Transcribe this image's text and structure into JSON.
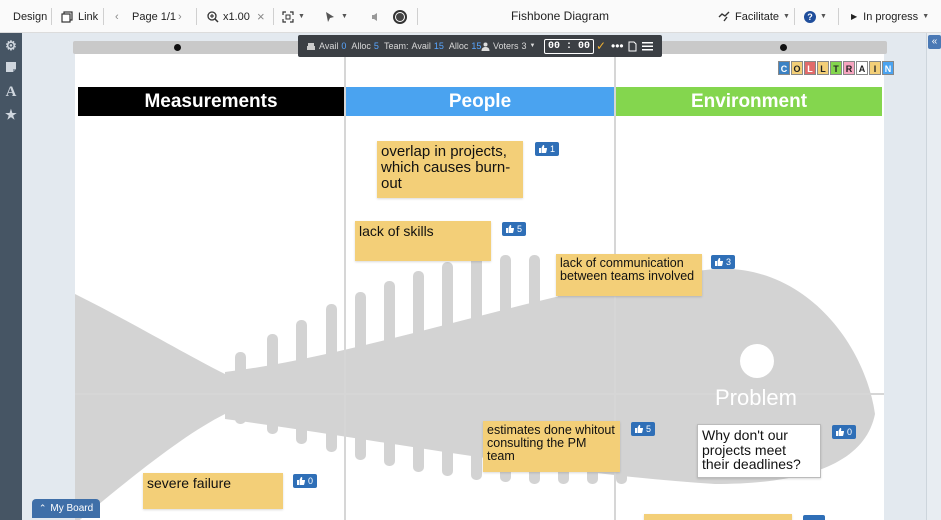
{
  "toolbar": {
    "design_label": "Design",
    "link_label": "Link",
    "page_label": "Page 1/1",
    "zoom_label": "x1.00",
    "title": "Fishbone Diagram",
    "facilitate_label": "Facilitate",
    "status_label": "In progress"
  },
  "status_bar": {
    "avail_label": "Avail",
    "avail_value": "0",
    "alloc_label": "Alloc",
    "alloc_value": "5",
    "team_label": "Team:",
    "team_avail_label": "Avail",
    "team_avail_value": "15",
    "team_alloc_label": "Alloc",
    "team_alloc_value": "15",
    "voters_label": "Voters",
    "voters_value": "3",
    "timer": "00 : 00"
  },
  "logo_letters": [
    "C",
    "O",
    "L",
    "L",
    "T",
    "R",
    "A",
    "I",
    "N"
  ],
  "columns": [
    {
      "title": "Measurements",
      "color": "#000000"
    },
    {
      "title": "People",
      "color": "#4aa3f0"
    },
    {
      "title": "Environment",
      "color": "#84d64e"
    }
  ],
  "notes": [
    {
      "text": "overlap in projects, which causes burn-out",
      "votes": "1"
    },
    {
      "text": "lack of skills",
      "votes": "5"
    },
    {
      "text": "lack of communication between teams involved",
      "votes": "3"
    },
    {
      "text": "estimates done whitout consulting the PM team",
      "votes": "5"
    },
    {
      "text": "severe failure",
      "votes": "0"
    },
    {
      "text": "Why don't our projects meet their deadlines?",
      "votes": "0"
    }
  ],
  "problem_label": "Problem",
  "my_board_label": "My Board",
  "colors": {
    "sticky": "#f3cf78",
    "vote": "#2f6fb7",
    "fish": "#d3d3d3",
    "sidebar": "#465564"
  }
}
